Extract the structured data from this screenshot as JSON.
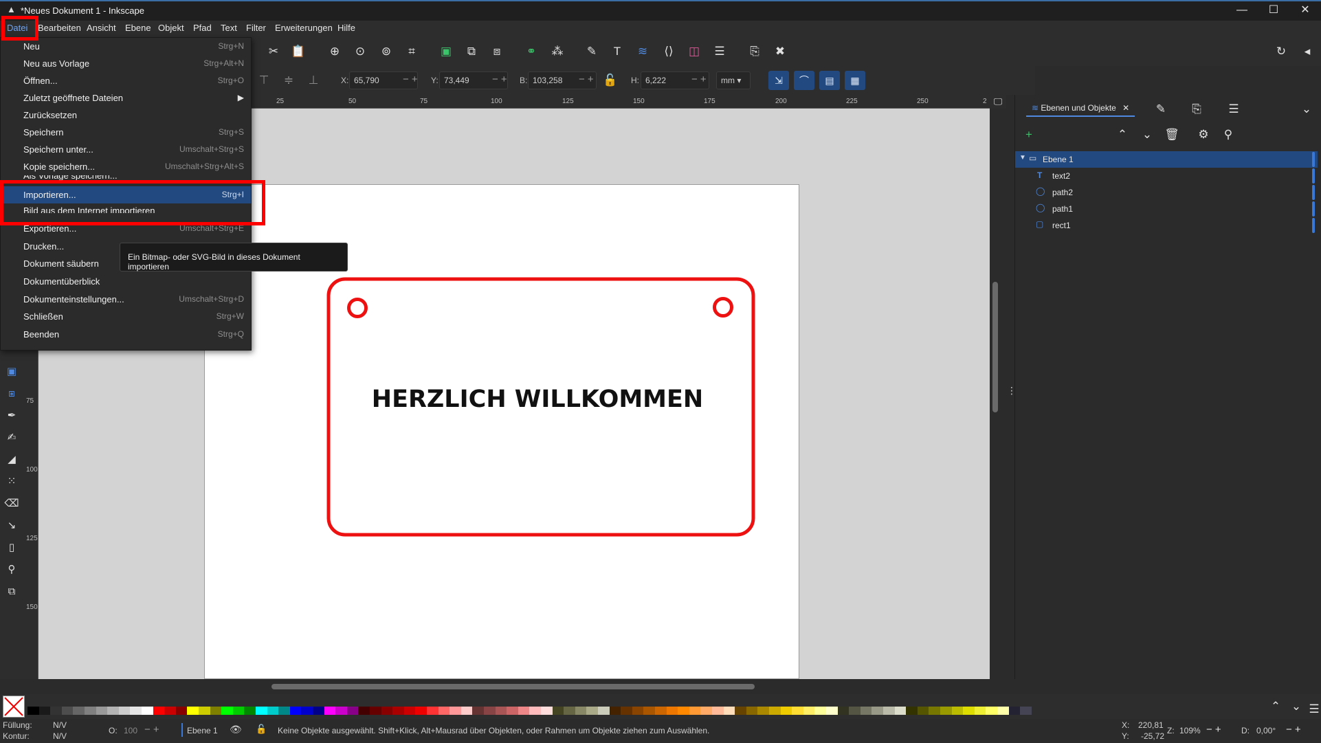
{
  "window": {
    "title": "*Neues Dokument 1 - Inkscape",
    "minimize": "—",
    "maximize": "☐",
    "close": "✕"
  },
  "menubar": [
    "Datei",
    "Bearbeiten",
    "Ansicht",
    "Ebene",
    "Objekt",
    "Pfad",
    "Text",
    "Filter",
    "Erweiterungen",
    "Hilfe"
  ],
  "file_menu": {
    "items": [
      {
        "label": "Neu",
        "shortcut": "Strg+N"
      },
      {
        "label": "Neu aus Vorlage",
        "shortcut": "Strg+Alt+N"
      },
      {
        "label": "Öffnen...",
        "shortcut": "Strg+O"
      },
      {
        "label": "Zuletzt geöffnete Dateien",
        "shortcut": "▶"
      },
      {
        "label": "Zurücksetzen",
        "shortcut": ""
      },
      {
        "label": "Speichern",
        "shortcut": "Strg+S"
      },
      {
        "label": "Speichern unter...",
        "shortcut": "Umschalt+Strg+S"
      },
      {
        "label": "Kopie speichern...",
        "shortcut": "Umschalt+Strg+Alt+S"
      },
      {
        "label": "Als Vorlage speichern...",
        "shortcut": ""
      },
      {
        "label": "Importieren...",
        "shortcut": "Strg+I"
      },
      {
        "label": "Bild aus dem Internet importieren",
        "shortcut": ""
      },
      {
        "label": "Exportieren...",
        "shortcut": "Umschalt+Strg+E"
      },
      {
        "label": "Drucken...",
        "shortcut": ""
      },
      {
        "label": "Dokument säubern",
        "shortcut": ""
      },
      {
        "label": "Dokumentüberblick",
        "shortcut": ""
      },
      {
        "label": "Dokumenteinstellungen...",
        "shortcut": "Umschalt+Strg+D"
      },
      {
        "label": "Schließen",
        "shortcut": "Strg+W"
      },
      {
        "label": "Beenden",
        "shortcut": "Strg+Q"
      }
    ],
    "highlighted": "Importieren..."
  },
  "tooltip": "Ein Bitmap- oder SVG-Bild in dieses Dokument importieren",
  "tool_controls": {
    "x_label": "X:",
    "x_value": "65,790",
    "y_label": "Y:",
    "y_value": "73,449",
    "w_label": "B:",
    "w_value": "103,258",
    "h_label": "H:",
    "h_value": "6,222",
    "unit": "mm"
  },
  "ruler_h": [
    "25",
    "50",
    "75",
    "100",
    "125",
    "150",
    "175",
    "200",
    "225",
    "250",
    "2"
  ],
  "ruler_v": [
    "75",
    "100",
    "125",
    "150"
  ],
  "canvas": {
    "text": "HERZLICH WILLKOMMEN",
    "stroke_color": "#ee1111"
  },
  "panel": {
    "tab_label": "Ebenen und Objekte",
    "layer": "Ebene 1",
    "objects": [
      {
        "name": "text2",
        "icon": "text-icon"
      },
      {
        "name": "path2",
        "icon": "circle-icon"
      },
      {
        "name": "path1",
        "icon": "circle-icon"
      },
      {
        "name": "rect1",
        "icon": "rect-icon"
      }
    ]
  },
  "status": {
    "fill_label": "Füllung:",
    "fill_value": "N/V",
    "stroke_label": "Kontur:",
    "stroke_value": "N/V",
    "opacity_label": "O:",
    "opacity_value": "100",
    "layer": "Ebene 1",
    "message": "Keine Objekte ausgewählt. Shift+Klick, Alt+Mausrad über Objekten, oder Rahmen um Objekte ziehen zum Auswählen.",
    "cursor_x_label": "X:",
    "cursor_x": "220,81",
    "cursor_y_label": "Y:",
    "cursor_y": "-25,72",
    "zoom_label": "Z:",
    "zoom": "109%",
    "rotation_label": "D:",
    "rotation": "0,00°"
  },
  "colors": {
    "accent": "#234a80",
    "annotation": "#ff0000"
  }
}
